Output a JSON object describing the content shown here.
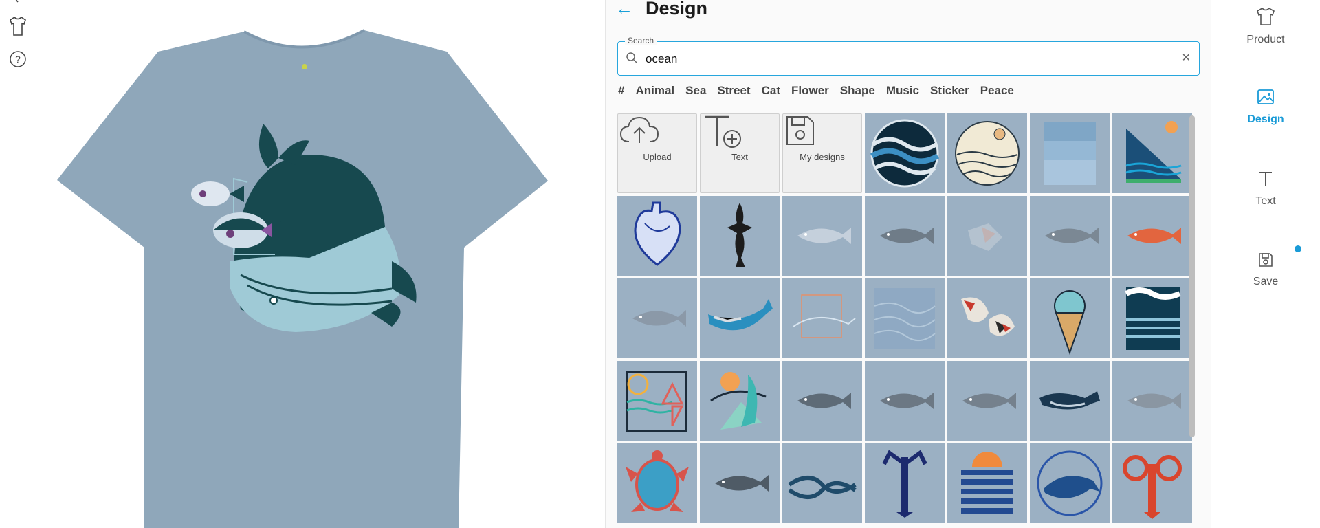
{
  "panel": {
    "title": "Design",
    "back_icon": "arrow-left-icon"
  },
  "search": {
    "label": "Search",
    "value": "ocean",
    "placeholder": "",
    "clear_icon": "close-icon"
  },
  "tags": [
    "#",
    "Animal",
    "Sea",
    "Street",
    "Cat",
    "Flower",
    "Shape",
    "Music",
    "Sticker",
    "Peace"
  ],
  "actions": [
    {
      "label": "Upload",
      "icon": "cloud-upload-icon"
    },
    {
      "label": "Text",
      "icon": "text-add-icon"
    },
    {
      "label": "My designs",
      "icon": "floppy-disk-icon"
    }
  ],
  "designs": [
    "wave-circle-design",
    "sun-waves-circle-design",
    "blue-gradient-square-design",
    "mountain-sun-waves-design",
    "anatomical-heart-design",
    "black-lizard-design",
    "tuna-design",
    "trout-design",
    "faded-mosaic-design",
    "herring-design",
    "red-fish-design",
    "bass-fish-design",
    "knit-whale-design",
    "line-whale-design",
    "wave-pattern-design",
    "koi-fish-design",
    "ice-cream-cone-design",
    "ocean-waves-stripes-design",
    "geometric-sun-sail-design",
    "surf-wave-sun-design",
    "grey-fish-design",
    "carp-design",
    "roach-fish-design",
    "humpback-whale-design",
    "pike-design",
    "sea-turtle-design",
    "carp-sketch-design",
    "rope-knot-design",
    "navy-lobster-design",
    "sunset-stripes-design",
    "whale-circle-design",
    "red-lobster-design"
  ],
  "right_nav": [
    {
      "label": "Product",
      "icon": "tshirt-icon",
      "active": false
    },
    {
      "label": "Design",
      "icon": "image-icon",
      "active": true
    },
    {
      "label": "Text",
      "icon": "text-icon",
      "active": false
    },
    {
      "label": "Save",
      "icon": "floppy-disk-icon",
      "active": false
    }
  ],
  "left_tools": [
    "tshirt-outline-icon",
    "help-circle-icon"
  ],
  "colors": {
    "accent": "#1a9bd7",
    "shirt": "#8fa7ba",
    "tile_bg": "#9bb0c3",
    "whale_dark": "#17494f",
    "whale_light": "#9fcad6"
  }
}
